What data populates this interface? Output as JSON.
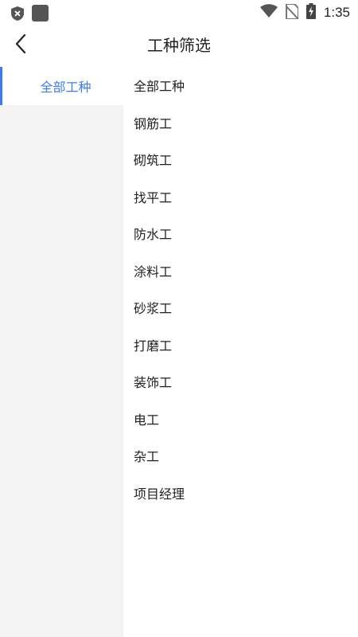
{
  "status_bar": {
    "time": "1:35",
    "left_icons": [
      "shield-icon",
      "app-square-icon"
    ],
    "right_icons": [
      "wifi-icon",
      "no-sim-icon",
      "battery-charging-icon"
    ]
  },
  "header": {
    "title": "工种筛选",
    "back_icon": "chevron-left-icon"
  },
  "sidebar": {
    "items": [
      {
        "label": "全部工种",
        "active": true
      }
    ]
  },
  "worker_types": [
    "全部工种",
    "钢筋工",
    "砌筑工",
    "找平工",
    "防水工",
    "涂料工",
    "砂浆工",
    "打磨工",
    "装饰工",
    "电工",
    "杂工",
    "项目经理"
  ],
  "colors": {
    "accent": "#3b7cf0",
    "sidebar_bg": "#f3f3f3",
    "text": "#222222"
  }
}
